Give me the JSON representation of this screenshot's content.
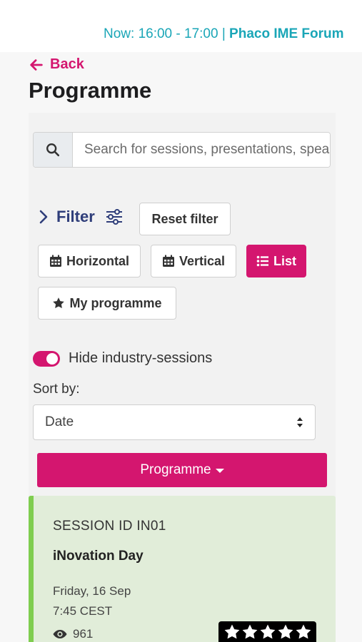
{
  "header": {
    "now_text": "Now: 16:00 - 17:00 | ",
    "now_event": "Phaco IME Forum"
  },
  "nav": {
    "back_label": "Back"
  },
  "page": {
    "title": "Programme"
  },
  "search": {
    "placeholder": "Search for sessions, presentations, speakers",
    "value": ""
  },
  "filters": {
    "filter_label": "Filter",
    "reset_label": "Reset filter",
    "views": [
      {
        "label": "Horizontal",
        "icon": "calendar-icon",
        "active": false
      },
      {
        "label": "Vertical",
        "icon": "calendar-icon",
        "active": false
      },
      {
        "label": "List",
        "icon": "list-icon",
        "active": true
      }
    ],
    "my_programme_label": "My programme"
  },
  "industry_toggle": {
    "label": "Hide industry-sessions",
    "checked": true
  },
  "sort": {
    "label": "Sort by:",
    "selected": "Date"
  },
  "programme_button": {
    "label": "Programme"
  },
  "sessions": [
    {
      "session_id": "SESSION ID IN01",
      "name": "iNovation Day",
      "date": "Friday, 16 Sep",
      "time": "7:45 CEST",
      "views": "961",
      "rating": 5
    }
  ],
  "colors": {
    "accent": "#d4166f",
    "teal": "#1aa6b7",
    "navy": "#2f3e7a",
    "card_bg": "#e1edd9",
    "card_border": "#7fcd4f"
  }
}
